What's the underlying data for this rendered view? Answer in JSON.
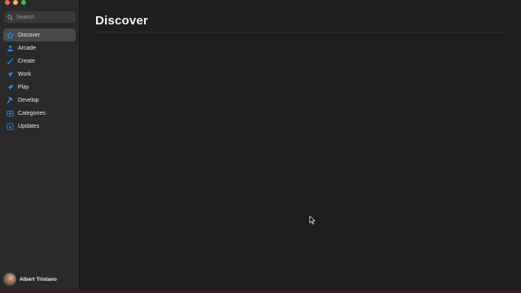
{
  "search": {
    "placeholder": "Search"
  },
  "sidebar": {
    "items": [
      {
        "label": "Discover",
        "icon": "star-icon",
        "active": true
      },
      {
        "label": "Arcade",
        "icon": "joystick-icon",
        "active": false
      },
      {
        "label": "Create",
        "icon": "brush-icon",
        "active": false
      },
      {
        "label": "Work",
        "icon": "paper-plane-icon",
        "active": false
      },
      {
        "label": "Play",
        "icon": "rocket-icon",
        "active": false
      },
      {
        "label": "Develop",
        "icon": "hammer-icon",
        "active": false
      },
      {
        "label": "Categories",
        "icon": "grid-icon",
        "active": false
      },
      {
        "label": "Updates",
        "icon": "download-icon",
        "active": false
      }
    ]
  },
  "user": {
    "name": "Albert  Tristano"
  },
  "main": {
    "title": "Discover"
  },
  "colors": {
    "accent": "#2f8cff",
    "sidebar_bg": "#2a2a2a",
    "content_bg": "#1e1e1e"
  }
}
